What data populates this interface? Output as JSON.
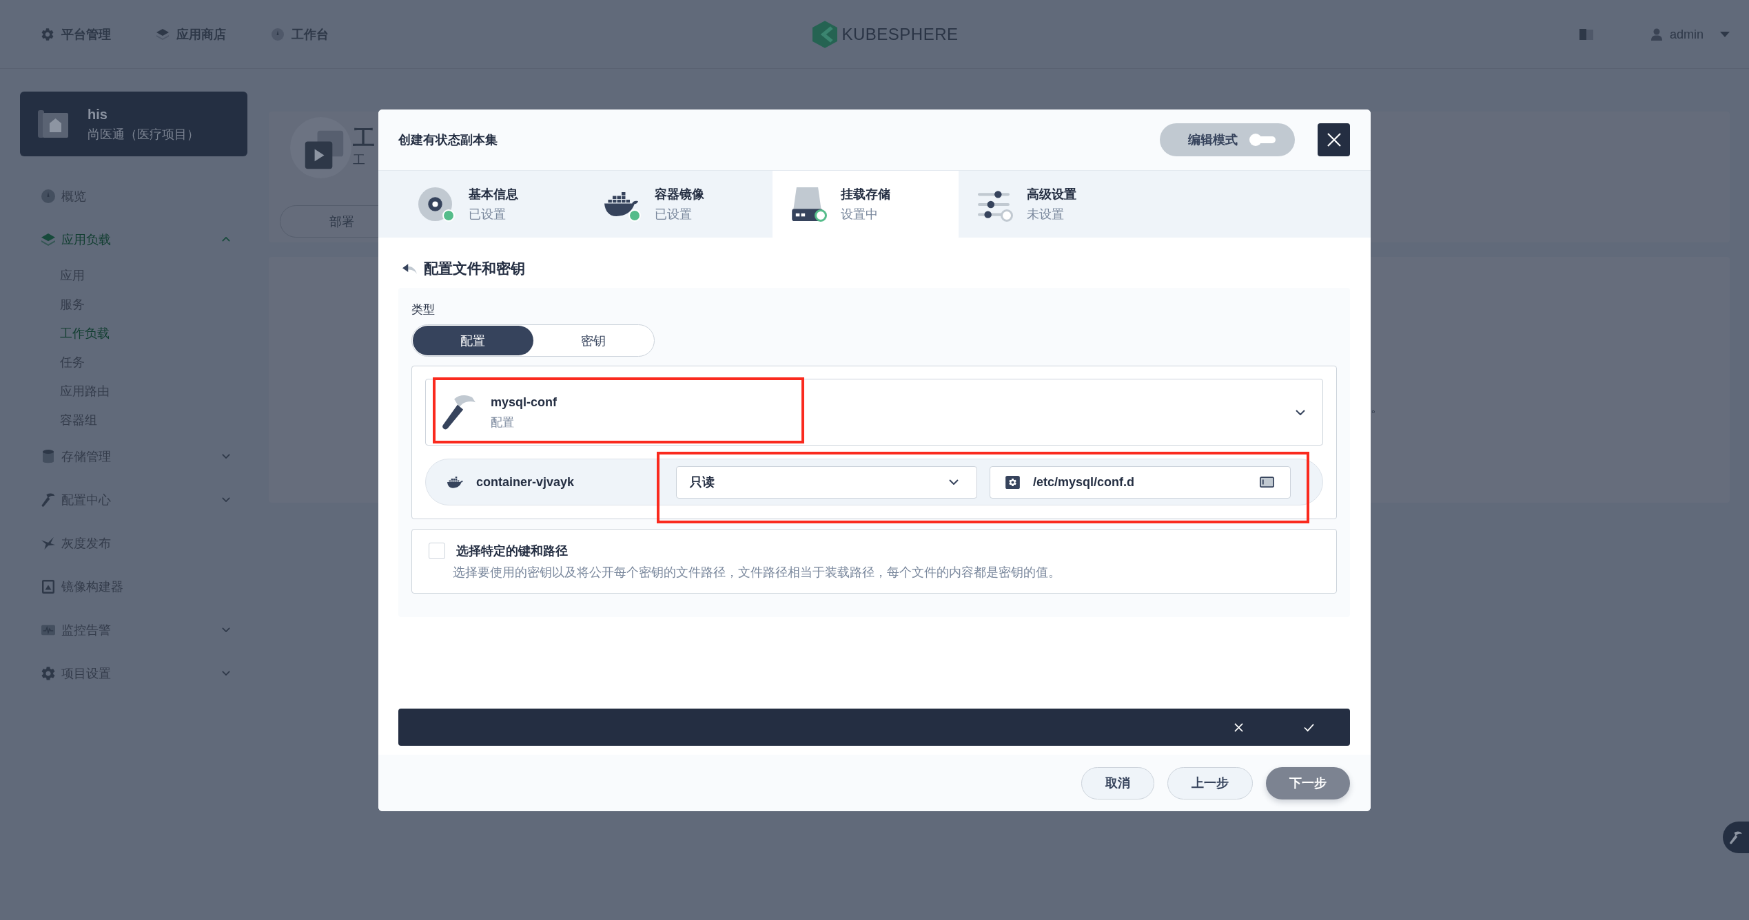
{
  "top_bar": {
    "nav": [
      {
        "label": "平台管理"
      },
      {
        "label": "应用商店"
      },
      {
        "label": "工作台"
      }
    ],
    "logo": "KUBESPHERE",
    "user": "admin"
  },
  "sidebar": {
    "project": {
      "name": "his",
      "description": "尚医通（医疗项目）"
    },
    "items": [
      {
        "label": "概览",
        "kind": "link",
        "selected": false
      },
      {
        "label": "应用负载",
        "kind": "group",
        "selected": true,
        "expanded": true,
        "children": [
          {
            "label": "应用",
            "selected": false
          },
          {
            "label": "服务",
            "selected": false
          },
          {
            "label": "工作负载",
            "selected": true
          },
          {
            "label": "任务",
            "selected": false
          },
          {
            "label": "应用路由",
            "selected": false
          },
          {
            "label": "容器组",
            "selected": false
          }
        ]
      },
      {
        "label": "存储管理",
        "kind": "group",
        "selected": false,
        "expanded": false
      },
      {
        "label": "配置中心",
        "kind": "group",
        "selected": false,
        "expanded": false
      },
      {
        "label": "灰度发布",
        "kind": "link",
        "selected": false
      },
      {
        "label": "镜像构建器",
        "kind": "link",
        "selected": false
      },
      {
        "label": "监控告警",
        "kind": "group",
        "selected": false,
        "expanded": false
      },
      {
        "label": "项目设置",
        "kind": "group",
        "selected": false,
        "expanded": false
      }
    ]
  },
  "page": {
    "header": {
      "title": "工",
      "subtitle": "工"
    },
    "tabs": [
      {
        "label": "部署",
        "selected": false
      }
    ],
    "content": {
      "text": "。"
    }
  },
  "modal": {
    "title": "创建有状态副本集",
    "edit_mode": {
      "label": "编辑模式",
      "on": false
    },
    "steps": [
      {
        "title": "基本信息",
        "status": "已设置",
        "completed": true,
        "selected": false
      },
      {
        "title": "容器镜像",
        "status": "已设置",
        "completed": true,
        "selected": false
      },
      {
        "title": "挂载存储",
        "status": "设置中",
        "completed": false,
        "selected": true
      },
      {
        "title": "高级设置",
        "status": "未设置",
        "completed": false,
        "selected": false
      }
    ],
    "section": {
      "title": "配置文件和密钥"
    },
    "form": {
      "type": {
        "label": "类型",
        "options": [
          {
            "label": "配置",
            "selected": true
          },
          {
            "label": "密钥",
            "selected": false
          }
        ]
      },
      "resource": {
        "name": "mysql-conf",
        "type": "配置"
      },
      "mount": {
        "container": "container-vjvayk",
        "access": "只读",
        "path": "/etc/mysql/conf.d"
      },
      "specific_keys": {
        "label": "选择特定的键和路径",
        "description": "选择要使用的密钥以及将公开每个密钥的文件路径，文件路径相当于装载路径，每个文件的内容都是密钥的值。",
        "checked": false
      }
    },
    "footer": {
      "buttons": [
        {
          "label": "取消",
          "kind": "default",
          "disabled": false
        },
        {
          "label": "上一步",
          "kind": "default",
          "disabled": false
        },
        {
          "label": "下一步",
          "kind": "primary",
          "disabled": true
        }
      ]
    }
  }
}
